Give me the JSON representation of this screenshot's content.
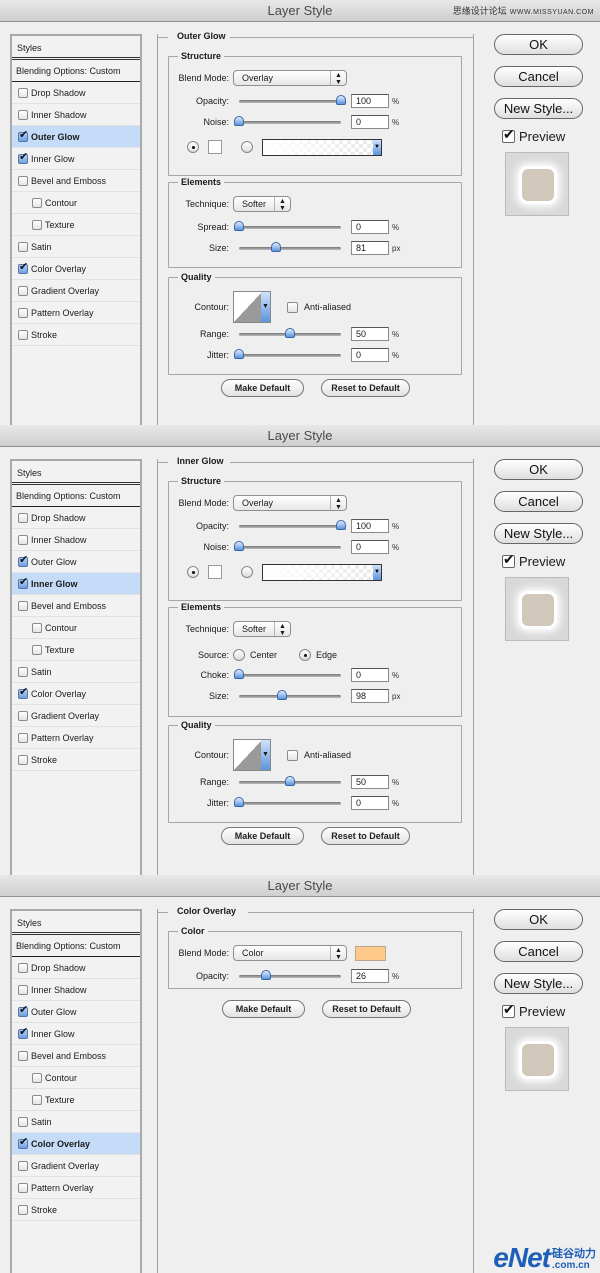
{
  "watermark_top": {
    "text": "思缘设计论坛",
    "url": "WWW.MISSYUAN.COM"
  },
  "watermark_bottom": {
    "brand": "eNet",
    "zh": "硅谷动力",
    "domain": ".com.cn"
  },
  "common": {
    "window_title": "Layer Style",
    "styles_header": "Styles",
    "blending_options": "Blending Options: Custom",
    "buttons": {
      "ok": "OK",
      "cancel": "Cancel",
      "new_style": "New Style...",
      "make_default": "Make Default",
      "reset_default": "Reset to Default"
    },
    "preview_label": "Preview",
    "preview_checked": true
  },
  "dialogs": [
    {
      "selected_style": "Outer Glow",
      "styles": [
        {
          "label": "Drop Shadow",
          "checked": false
        },
        {
          "label": "Inner Shadow",
          "checked": false
        },
        {
          "label": "Outer Glow",
          "checked": true
        },
        {
          "label": "Inner Glow",
          "checked": true
        },
        {
          "label": "Bevel and Emboss",
          "checked": false
        },
        {
          "label": "Contour",
          "checked": false
        },
        {
          "label": "Texture",
          "checked": false
        },
        {
          "label": "Satin",
          "checked": false
        },
        {
          "label": "Color Overlay",
          "checked": true
        },
        {
          "label": "Gradient Overlay",
          "checked": false
        },
        {
          "label": "Pattern Overlay",
          "checked": false
        },
        {
          "label": "Stroke",
          "checked": false
        }
      ],
      "panel_title": "Outer Glow",
      "structure": {
        "title": "Structure",
        "blend_mode_label": "Blend Mode:",
        "blend_mode": "Overlay",
        "opacity_label": "Opacity:",
        "opacity": "100",
        "opacity_unit": "%",
        "noise_label": "Noise:",
        "noise": "0",
        "noise_unit": "%",
        "fill_type": "color",
        "color": "#ffffff"
      },
      "elements": {
        "title": "Elements",
        "technique_label": "Technique:",
        "technique": "Softer",
        "spread_label": "Spread:",
        "spread": "0",
        "spread_unit": "%",
        "size_label": "Size:",
        "size": "81",
        "size_unit": "px"
      },
      "quality": {
        "title": "Quality",
        "contour_label": "Contour:",
        "anti_aliased_label": "Anti-aliased",
        "anti_aliased": false,
        "range_label": "Range:",
        "range": "50",
        "range_unit": "%",
        "jitter_label": "Jitter:",
        "jitter": "0",
        "jitter_unit": "%"
      }
    },
    {
      "selected_style": "Inner Glow",
      "panel_title": "Inner Glow",
      "structure": {
        "title": "Structure",
        "blend_mode_label": "Blend Mode:",
        "blend_mode": "Overlay",
        "opacity_label": "Opacity:",
        "opacity": "100",
        "opacity_unit": "%",
        "noise_label": "Noise:",
        "noise": "0",
        "noise_unit": "%",
        "fill_type": "color",
        "color": "#ffffff"
      },
      "elements": {
        "title": "Elements",
        "technique_label": "Technique:",
        "technique": "Softer",
        "source_label": "Source:",
        "source_center": "Center",
        "source_edge": "Edge",
        "source": "Edge",
        "choke_label": "Choke:",
        "choke": "0",
        "choke_unit": "%",
        "size_label": "Size:",
        "size": "98",
        "size_unit": "px"
      },
      "quality": {
        "title": "Quality",
        "contour_label": "Contour:",
        "anti_aliased_label": "Anti-aliased",
        "anti_aliased": false,
        "range_label": "Range:",
        "range": "50",
        "range_unit": "%",
        "jitter_label": "Jitter:",
        "jitter": "0",
        "jitter_unit": "%"
      }
    },
    {
      "selected_style": "Color Overlay",
      "panel_title": "Color Overlay",
      "color": {
        "title": "Color",
        "blend_mode_label": "Blend Mode:",
        "blend_mode": "Color",
        "swatch": "#fdca8a",
        "opacity_label": "Opacity:",
        "opacity": "26",
        "opacity_unit": "%"
      }
    }
  ]
}
